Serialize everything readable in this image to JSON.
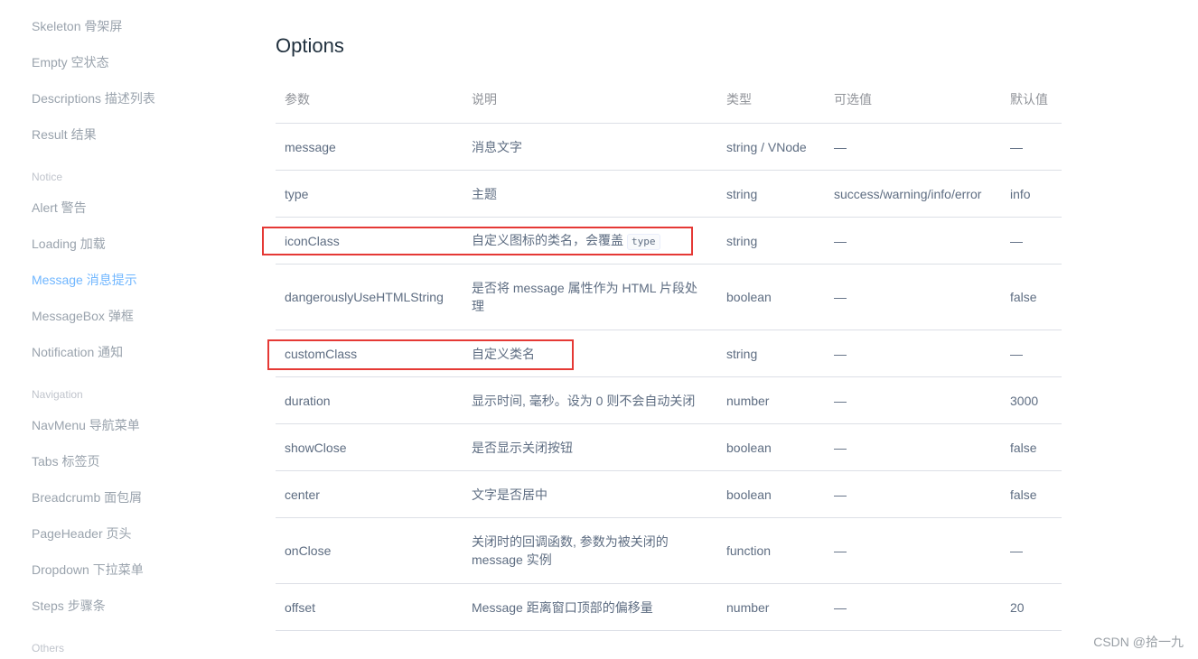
{
  "sidebar": {
    "items": [
      {
        "label": "Skeleton 骨架屏"
      },
      {
        "label": "Empty 空状态"
      },
      {
        "label": "Descriptions 描述列表"
      },
      {
        "label": "Result 结果"
      },
      {
        "group": "Notice"
      },
      {
        "label": "Alert 警告"
      },
      {
        "label": "Loading 加载"
      },
      {
        "label": "Message 消息提示",
        "active": true
      },
      {
        "label": "MessageBox 弹框"
      },
      {
        "label": "Notification 通知"
      },
      {
        "group": "Navigation"
      },
      {
        "label": "NavMenu 导航菜单"
      },
      {
        "label": "Tabs 标签页"
      },
      {
        "label": "Breadcrumb 面包屑"
      },
      {
        "label": "PageHeader 页头"
      },
      {
        "label": "Dropdown 下拉菜单"
      },
      {
        "label": "Steps 步骤条"
      },
      {
        "group": "Others"
      }
    ]
  },
  "main": {
    "title": "Options",
    "table": {
      "headers": [
        "参数",
        "说明",
        "类型",
        "可选值",
        "默认值"
      ],
      "rows": [
        {
          "param": "message",
          "desc": "消息文字",
          "type": "string / VNode",
          "options": "—",
          "default": "—"
        },
        {
          "param": "type",
          "desc": "主题",
          "type": "string",
          "options": "success/warning/info/error",
          "default": "info"
        },
        {
          "param": "iconClass",
          "desc": "自定义图标的类名，会覆盖",
          "code": "type",
          "type": "string",
          "options": "—",
          "default": "—",
          "highlighted": true
        },
        {
          "param": "dangerouslyUseHTMLString",
          "desc": "是否将 message 属性作为 HTML 片段处理",
          "type": "boolean",
          "options": "—",
          "default": "false"
        },
        {
          "param": "customClass",
          "desc": "自定义类名",
          "type": "string",
          "options": "—",
          "default": "—",
          "highlighted": true
        },
        {
          "param": "duration",
          "desc": "显示时间, 毫秒。设为 0 则不会自动关闭",
          "type": "number",
          "options": "—",
          "default": "3000"
        },
        {
          "param": "showClose",
          "desc": "是否显示关闭按钮",
          "type": "boolean",
          "options": "—",
          "default": "false"
        },
        {
          "param": "center",
          "desc": "文字是否居中",
          "type": "boolean",
          "options": "—",
          "default": "false"
        },
        {
          "param": "onClose",
          "desc": "关闭时的回调函数, 参数为被关闭的 message 实例",
          "type": "function",
          "options": "—",
          "default": "—"
        },
        {
          "param": "offset",
          "desc": "Message 距离窗口顶部的偏移量",
          "type": "number",
          "options": "—",
          "default": "20"
        }
      ]
    }
  },
  "watermark": "CSDN @拾一九",
  "colors": {
    "accent": "#409eff",
    "highlight": "#e53935",
    "title": "#1f2f3d",
    "text": "#5e6d82"
  }
}
